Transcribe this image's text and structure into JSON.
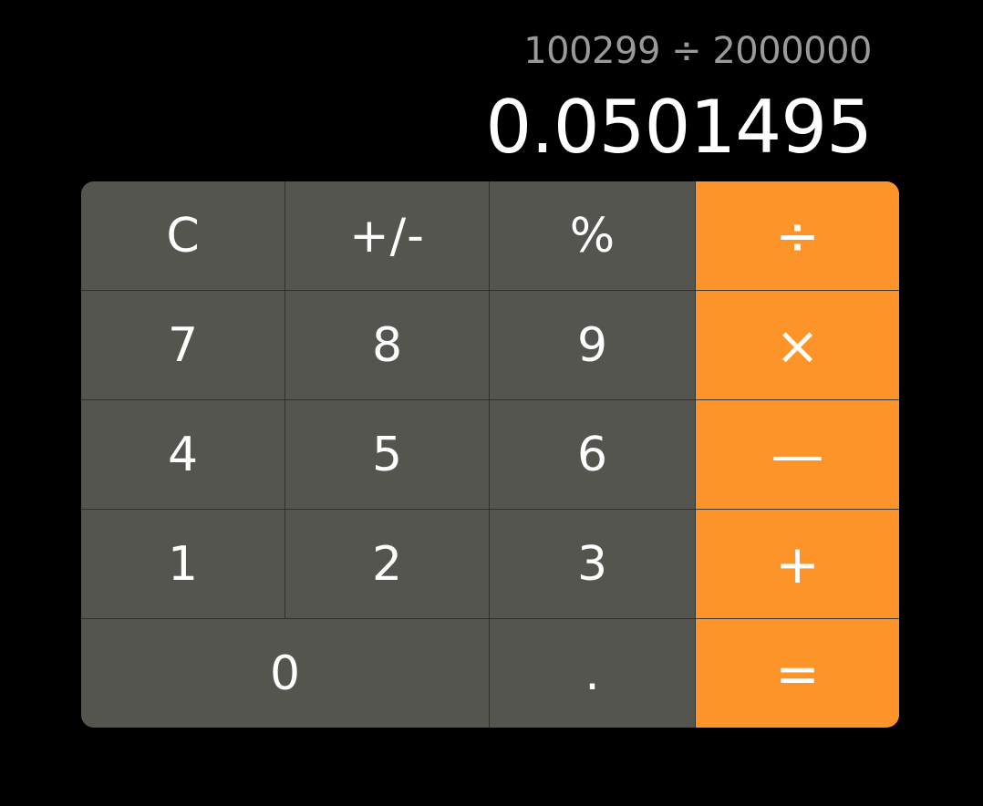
{
  "display": {
    "expression": "100299 ÷ 2000000",
    "result": "0.0501495"
  },
  "keys": {
    "clear": "C",
    "sign": "+/-",
    "percent": "%",
    "divide": "÷",
    "seven": "7",
    "eight": "8",
    "nine": "9",
    "multiply": "×",
    "four": "4",
    "five": "5",
    "six": "6",
    "subtract": "—",
    "one": "1",
    "two": "2",
    "three": "3",
    "add": "+",
    "zero": "0",
    "decimal": ".",
    "equals": "="
  },
  "colors": {
    "background": "#000000",
    "key": "#555550",
    "operator": "#fd942a",
    "expression_text": "#9a9a9a",
    "result_text": "#ffffff"
  }
}
